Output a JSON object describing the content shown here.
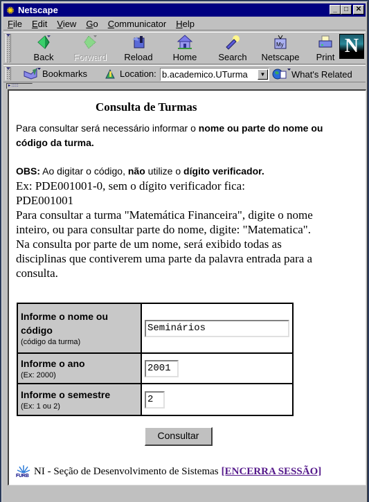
{
  "window": {
    "title": "Netscape",
    "controls": {
      "minimize": "_",
      "maximize": "□",
      "close": "✕"
    }
  },
  "menubar": {
    "items": [
      {
        "label": "File",
        "accel": "F"
      },
      {
        "label": "Edit",
        "accel": "E"
      },
      {
        "label": "View",
        "accel": "V"
      },
      {
        "label": "Go",
        "accel": "G"
      },
      {
        "label": "Communicator",
        "accel": "C"
      },
      {
        "label": "Help",
        "accel": "H"
      }
    ]
  },
  "toolbar": {
    "buttons": [
      {
        "label": "Back",
        "icon": "back-arrow-icon",
        "enabled": true
      },
      {
        "label": "Forward",
        "icon": "forward-arrow-icon",
        "enabled": false
      },
      {
        "label": "Reload",
        "icon": "reload-icon",
        "enabled": true
      },
      {
        "label": "Home",
        "icon": "home-icon",
        "enabled": true
      },
      {
        "label": "Search",
        "icon": "search-flashlight-icon",
        "enabled": true
      },
      {
        "label": "Netscape",
        "icon": "my-netscape-icon",
        "enabled": true
      },
      {
        "label": "Print",
        "icon": "printer-icon",
        "enabled": true
      }
    ],
    "logo": "N"
  },
  "location_bar": {
    "bookmarks_label": "Bookmarks",
    "location_label": "Location:",
    "url_value": "b.academico.UTurma",
    "whats_related_label": "What's Related"
  },
  "page": {
    "title": "Consulta de Turmas",
    "intro_plain": "Para consultar  será necessário informar o ",
    "intro_bold": "nome ou parte do nome ou código da turma.",
    "obs_label": "OBS:",
    "obs_text1": " Ao digitar o código, ",
    "obs_bold1": "não",
    "obs_text2": " utilize o ",
    "obs_bold2": "dígito verificador.",
    "example_line1": "Ex: PDE001001-0, sem o dígito verificador fica:",
    "example_line2": "PDE001001",
    "explanation": "Para consultar a turma \"Matemática Financeira\", digite o nome inteiro, ou para consultar parte do nome, digite: \"Matematica\". Na consulta por parte de um nome, será exibido todas as disciplinas que contiverem uma parte da palavra entrada para a consulta."
  },
  "form": {
    "fields": [
      {
        "label": "Informe o nome ou código",
        "hint": "(código da turma)",
        "value": "Seminários"
      },
      {
        "label": "Informe o ano",
        "hint": "(Ex: 2000)",
        "value": "2001"
      },
      {
        "label": "Informe o semestre",
        "hint": "(Ex: 1 ou 2)",
        "value": "2"
      }
    ],
    "submit_label": "Consultar"
  },
  "footer": {
    "logo_text": "FURB",
    "text": "NI - Seção de Desenvolvimento de Sistemas",
    "end_session_link": "[ENCERRA SESSÃO]",
    "link_color": "#551a8b"
  },
  "colors": {
    "titlebar": "#000080",
    "chrome": "#c0c0c0",
    "label_cell": "#c8c8c8"
  }
}
